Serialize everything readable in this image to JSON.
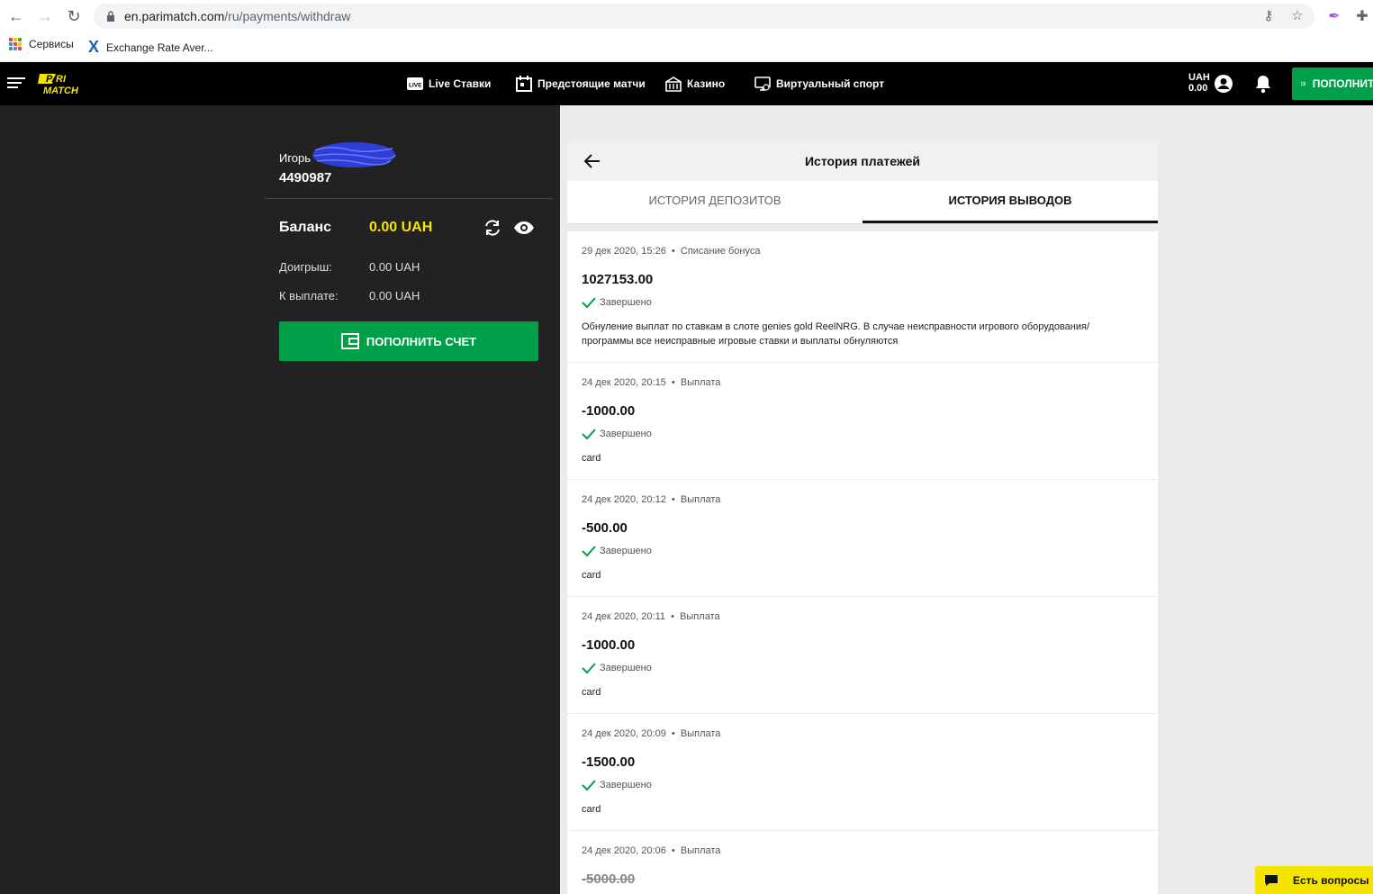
{
  "browser": {
    "url_host": "en.parimatch.com",
    "url_path": "/ru/payments/withdraw",
    "bookmarks": [
      {
        "label": "Сервисы",
        "icon": "apps-grid-icon"
      },
      {
        "label": "Exchange Rate Aver...",
        "icon": "x-logo-icon"
      }
    ]
  },
  "header": {
    "nav": [
      {
        "label": "Live Ставки",
        "icon": "live-icon"
      },
      {
        "label": "Предстоящие матчи",
        "icon": "calendar-icon"
      },
      {
        "label": "Казино",
        "icon": "casino-icon"
      },
      {
        "label": "Виртуальный спорт",
        "icon": "virtual-sport-icon"
      }
    ],
    "currency": "UAH",
    "balance": "0.00",
    "deposit_label": "ПОПОЛНИТЬ"
  },
  "account": {
    "name": "Игорь",
    "id": "4490987",
    "balance_label": "Баланс",
    "balance_value": "0.00 UAH",
    "rows": [
      {
        "label": "Доигрыш:",
        "value": "0.00 UAH"
      },
      {
        "label": "К выплате:",
        "value": "0.00 UAH"
      }
    ],
    "deposit_button": "ПОПОЛНИТЬ СЧЕТ"
  },
  "history": {
    "title": "История платежей",
    "tabs": [
      {
        "label": "ИСТОРИЯ ДЕПОЗИТОВ",
        "active": false
      },
      {
        "label": "ИСТОРИЯ ВЫВОДОВ",
        "active": true
      }
    ],
    "transactions": [
      {
        "date": "29 дек 2020, 15:26",
        "type": "Списание бонуса",
        "amount": "1027153.00",
        "status": "Завершено",
        "note": "Обнуление выплат по ставкам в слоте genies gold ReelNRG. В случае неисправности игрового оборудования/программы все неисправные игровые ставки и выплаты обнуляются"
      },
      {
        "date": "24 дек 2020, 20:15",
        "type": "Выплата",
        "amount": "-1000.00",
        "status": "Завершено",
        "note": "card"
      },
      {
        "date": "24 дек 2020, 20:12",
        "type": "Выплата",
        "amount": "-500.00",
        "status": "Завершено",
        "note": "card"
      },
      {
        "date": "24 дек 2020, 20:11",
        "type": "Выплата",
        "amount": "-1000.00",
        "status": "Завершено",
        "note": "card"
      },
      {
        "date": "24 дек 2020, 20:09",
        "type": "Выплата",
        "amount": "-1500.00",
        "status": "Завершено",
        "note": "card"
      },
      {
        "date": "24 дек 2020, 20:06",
        "type": "Выплата",
        "amount": "-5000.00",
        "status": "",
        "note": ""
      }
    ]
  },
  "chat": {
    "label": "Есть вопросы"
  },
  "colors": {
    "accent_green": "#00a04a",
    "brand_yellow": "#f5e400",
    "dark_panel": "#222222"
  }
}
